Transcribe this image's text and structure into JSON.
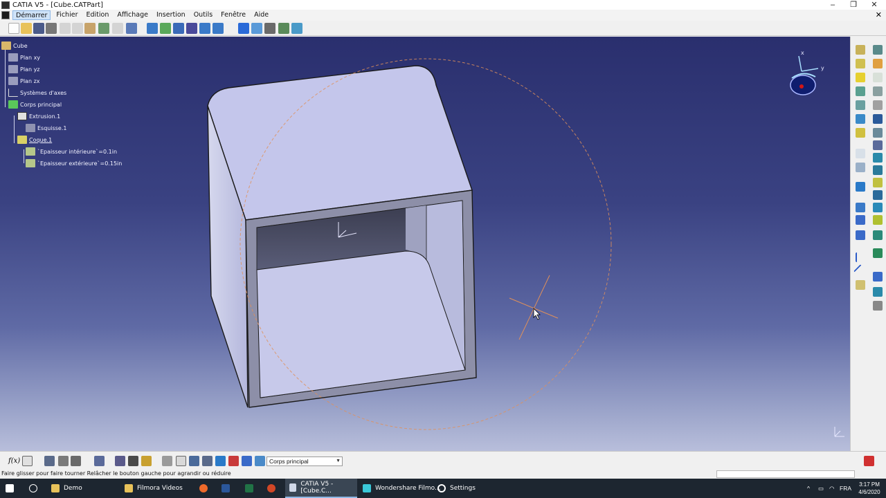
{
  "window": {
    "title": "CATIA V5 - [Cube.CATPart]",
    "controls": [
      "–",
      "❐",
      "✕"
    ]
  },
  "menu": {
    "items": [
      "Démarrer",
      "Fichier",
      "Edition",
      "Affichage",
      "Insertion",
      "Outils",
      "Fenêtre",
      "Aide"
    ],
    "close": "✕"
  },
  "tree": {
    "root": "Cube",
    "nodes": [
      {
        "label": "Plan xy",
        "icon": "plane-icon"
      },
      {
        "label": "Plan yz",
        "icon": "plane-icon"
      },
      {
        "label": "Plan zx",
        "icon": "plane-icon"
      },
      {
        "label": "Systèmes d'axes",
        "icon": "axis-system-icon"
      },
      {
        "label": "Corps principal",
        "icon": "body-icon"
      },
      {
        "label": "Extrusion.1",
        "icon": "pad-icon"
      },
      {
        "label": "Esquisse.1",
        "icon": "sketch-icon"
      },
      {
        "label": "Coque.1",
        "icon": "shell-icon"
      },
      {
        "label": "`Epaisseur intérieure`=0.1in",
        "icon": "parameter-icon"
      },
      {
        "label": "`Epaisseur extérieure`=0.15in",
        "icon": "parameter-icon"
      }
    ]
  },
  "compass": {
    "x": "x",
    "y": "y"
  },
  "bottom_toolbar": {
    "formula_label": "f(x)",
    "body_select": "Corps principal"
  },
  "statusbar": {
    "message": "Faire glisser pour faire tourner  Relâcher le bouton gauche pour agrandir ou réduire"
  },
  "taskbar": {
    "items": [
      {
        "label": "Demo",
        "icon": "folder-icon"
      },
      {
        "label": "Filmora Videos",
        "icon": "folder-icon"
      },
      {
        "label": "CATIA V5 - [Cube.C...",
        "icon": "catia-icon"
      },
      {
        "label": "Wondershare Filmo...",
        "icon": "filmora-icon"
      },
      {
        "label": "Settings",
        "icon": "gear-icon"
      }
    ],
    "lang": "FRA",
    "time": "3:17 PM",
    "date": "4/6/2020"
  },
  "colors": {
    "viewport_top": "#2a2f6e",
    "viewport_bottom": "#b8bedb",
    "part_face": "#c3c5e8",
    "part_edge": "#1a1a1a",
    "highlight": "#e0905a"
  }
}
